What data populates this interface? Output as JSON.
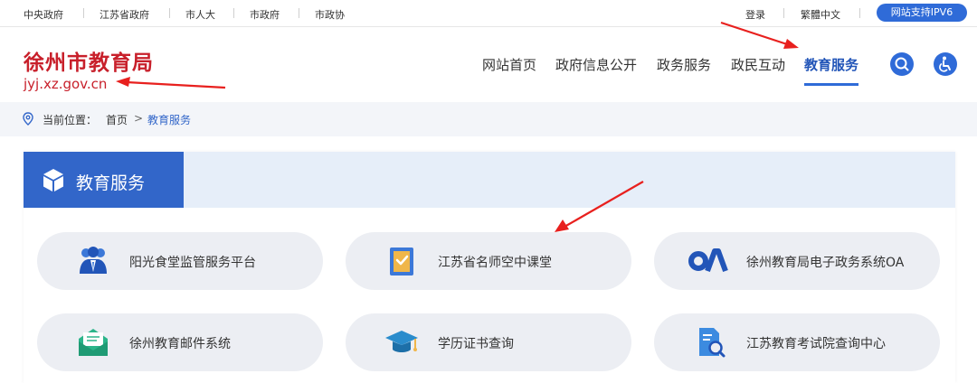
{
  "topbar": {
    "left_links": [
      "中央政府",
      "江苏省政府",
      "市人大",
      "市政府",
      "市政协"
    ],
    "login": "登录",
    "traditional": "繁體中文",
    "ipv6": "网站支持IPV6"
  },
  "header": {
    "title": "徐州市教育局",
    "domain": "jyj.xz.gov.cn",
    "nav": [
      "网站首页",
      "政府信息公开",
      "政务服务",
      "政民互动",
      "教育服务"
    ],
    "active_nav": "教育服务",
    "icons": [
      "search-icon",
      "accessibility-icon"
    ]
  },
  "breadcrumb": {
    "label": "当前位置：",
    "home": "首页",
    "separator": ">",
    "current": "教育服务"
  },
  "panel": {
    "title": "教育服务",
    "services": [
      {
        "label": "阳光食堂监管服务平台",
        "icon": "people-icon"
      },
      {
        "label": "江苏省名师空中课堂",
        "icon": "certificate-icon"
      },
      {
        "label": "徐州教育局电子政务系统OA",
        "icon": "oa-logo-icon"
      },
      {
        "label": "徐州教育邮件系统",
        "icon": "mail-icon"
      },
      {
        "label": "学历证书查询",
        "icon": "graduation-cap-icon"
      },
      {
        "label": "江苏教育考试院查询中心",
        "icon": "document-search-icon"
      }
    ]
  },
  "colors": {
    "brand_red": "#c8202b",
    "accent_blue": "#2f6bd8",
    "arrow_red": "#e8201e"
  }
}
